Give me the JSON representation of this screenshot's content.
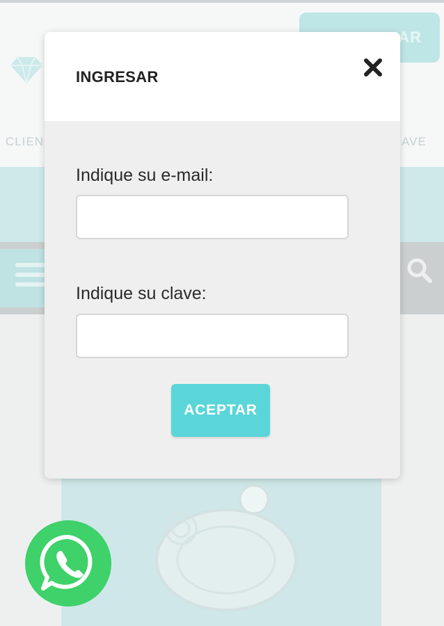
{
  "background": {
    "top_button_label": "AR",
    "client_label": "CLIEN",
    "key_label": "AVE",
    "icons": {
      "logo": "heart-gem-logo",
      "menu": "hamburger-menu-icon",
      "search": "search-icon"
    },
    "product_image": "silver-ring-photo"
  },
  "modal": {
    "title": "INGRESAR",
    "close_icon": "close-icon",
    "email": {
      "label": "Indique su e-mail:",
      "value": "",
      "placeholder": ""
    },
    "password": {
      "label": "Indique su clave:",
      "value": "",
      "placeholder": ""
    },
    "accept_label": "ACEPTAR"
  },
  "whatsapp": {
    "icon": "whatsapp-icon"
  },
  "colors": {
    "accent": "#5ad6d8",
    "whatsapp": "#3fd16a",
    "modal_bg": "#efefef"
  }
}
